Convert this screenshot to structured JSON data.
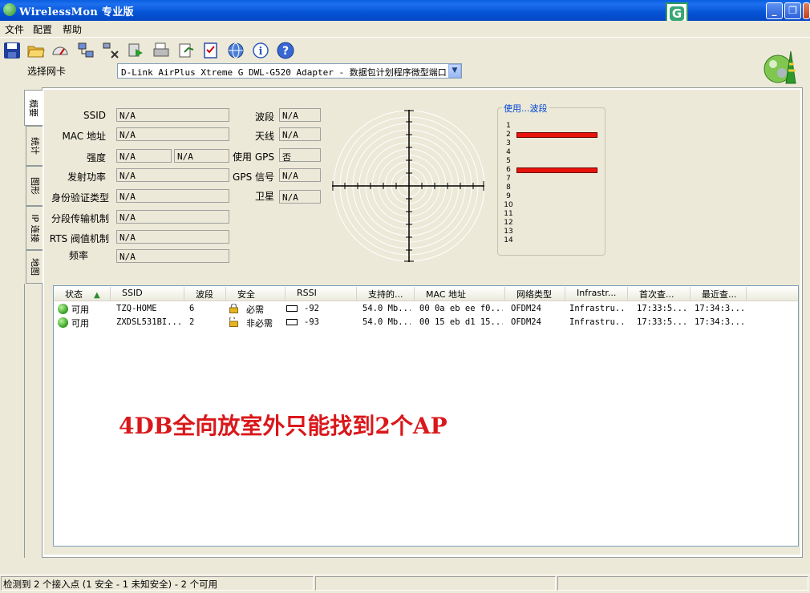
{
  "window": {
    "title": "WirelessMon 专业版"
  },
  "menu": [
    "文件",
    "配置",
    "帮助"
  ],
  "toolbar": {
    "icons": [
      "save-icon",
      "open-folder-icon",
      "gauge-icon",
      "network-connect-icon",
      "network-disconnect-icon",
      "play-log-icon",
      "print-icon",
      "export-icon",
      "checklist-icon",
      "globe-icon",
      "info-icon",
      "help-icon"
    ]
  },
  "adapter": {
    "label": "选择网卡",
    "value": "D-Link AirPlus Xtreme G DWL-G520 Adapter - 数据包计划程序微型端口"
  },
  "tabs": [
    "概要",
    "统计",
    "图形",
    "IP 连接",
    "地图"
  ],
  "summary_left": [
    {
      "label": "SSID",
      "value": "N/A"
    },
    {
      "label": "MAC 地址",
      "value": "N/A"
    },
    {
      "label": "强度",
      "value": "N/A",
      "value2": "N/A"
    },
    {
      "label": "发射功率",
      "value": "N/A"
    },
    {
      "label": "身份验证类型",
      "value": "N/A"
    },
    {
      "label": "分段传输机制",
      "value": "N/A"
    },
    {
      "label": "RTS 阀值机制",
      "value": "N/A"
    },
    {
      "label": "频率",
      "value": "N/A"
    }
  ],
  "summary_right": [
    {
      "label": "波段",
      "value": "N/A"
    },
    {
      "label": "天线",
      "value": "N/A"
    },
    {
      "label": "使用 GPS",
      "value": "否"
    },
    {
      "label": "GPS 信号",
      "value": "N/A"
    },
    {
      "label": "卫星",
      "value": "N/A"
    }
  ],
  "channel_usage": {
    "title": "使用...波段",
    "channels": [
      "1",
      "2",
      "3",
      "4",
      "5",
      "6",
      "7",
      "8",
      "9",
      "10",
      "11",
      "12",
      "13",
      "14"
    ],
    "used": [
      2,
      6
    ],
    "bar_color": "#e8130b"
  },
  "list": {
    "columns": [
      "状态",
      "SSID",
      "波段",
      "安全",
      "RSSI",
      "支持的...",
      "MAC 地址",
      "网络类型",
      "Infrastr...",
      "首次查...",
      "最近查..."
    ],
    "sort_indicator": "▲",
    "rows": [
      {
        "status": "可用",
        "ssid": "TZQ-HOME",
        "channel": "6",
        "security": "必需",
        "locked": true,
        "rssi": "-92",
        "rates": "54.0 Mb...",
        "mac": "00 0a eb ee f0...",
        "type": "OFDM24",
        "infra": "Infrastru...",
        "first": "17:33:5...",
        "last": "17:34:3..."
      },
      {
        "status": "可用",
        "ssid": "ZXDSL531BI...",
        "channel": "2",
        "security": "非必需",
        "locked": false,
        "rssi": "-93",
        "rates": "54.0 Mb...",
        "mac": "00 15 eb d1 15...",
        "type": "OFDM24",
        "infra": "Infrastru...",
        "first": "17:33:5...",
        "last": "17:34:3..."
      }
    ]
  },
  "annotation": "4DB全向放室外只能找到2个AP",
  "status_bar": "检测到 2 个接入点 (1 安全 - 1 未知安全) - 2 个可用"
}
